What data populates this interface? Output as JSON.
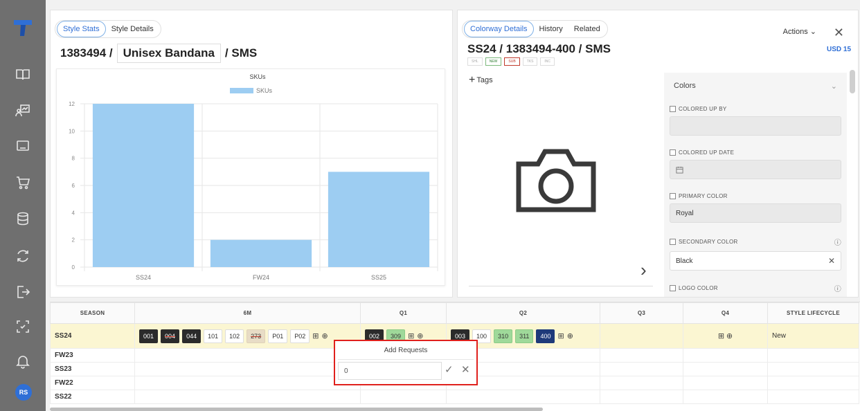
{
  "colors": {
    "sidebar": "#6f6f6f",
    "accent": "#2f6fd6",
    "bar": "#9dcdf2",
    "highlight_row": "#fbf6d2",
    "popup_border": "#e0201c"
  },
  "sidebar": {
    "logo_icon": "t-logo-icon",
    "items": [
      "book-icon",
      "chart-person-icon",
      "laptop-icon",
      "cart-icon",
      "database-icon",
      "sync-icon",
      "export-icon",
      "scan-icon",
      "bell-icon"
    ],
    "avatar": "RS"
  },
  "left": {
    "tabs": [
      {
        "label": "Style Stats",
        "active": true
      },
      {
        "label": "Style Details",
        "active": false
      }
    ],
    "title_prefix": "1383494 /",
    "title_name": "Unisex Bandana",
    "title_suffix": "/ SMS"
  },
  "chart_data": {
    "type": "bar",
    "title": "SKUs",
    "legend": [
      "SKUs"
    ],
    "legend_position": "top",
    "categories": [
      "SS24",
      "FW24",
      "SS25"
    ],
    "series": [
      {
        "name": "SKUs",
        "values": [
          12,
          2,
          7
        ]
      }
    ],
    "ylim": [
      0,
      12
    ],
    "yticks": [
      0,
      2,
      4,
      6,
      8,
      10,
      12
    ],
    "grid": true
  },
  "right": {
    "tabs": [
      {
        "label": "Colorway Details",
        "active": true
      },
      {
        "label": "History",
        "active": false
      },
      {
        "label": "Related",
        "active": false
      }
    ],
    "title": "SS24 / 1383494-400 / SMS",
    "badges": [
      "SHL",
      "NEW",
      "SUB",
      "TKS",
      "INC"
    ],
    "actions_label": "Actions",
    "close_icon": "close-icon",
    "currency": "USD 15",
    "tags_label": "Tags",
    "colors_section": {
      "header": "Colors",
      "fields": [
        {
          "label": "COLORED UP BY",
          "value": ""
        },
        {
          "label": "COLORED UP DATE",
          "value": ""
        },
        {
          "label": "PRIMARY COLOR",
          "value": "Royal"
        },
        {
          "label": "SECONDARY COLOR",
          "value": "Black"
        },
        {
          "label": "LOGO COLOR",
          "value": ""
        }
      ]
    }
  },
  "table": {
    "headers": [
      "SEASON",
      "6M",
      "Q1",
      "Q2",
      "Q3",
      "Q4",
      "STYLE LIFECYCLE"
    ],
    "rows": [
      {
        "season": "SS24",
        "m6": [
          "001",
          "004",
          "044",
          "101",
          "102",
          "273",
          "P01",
          "P02"
        ],
        "q1": [
          "002",
          "309"
        ],
        "q2": [
          "003",
          "100",
          "310",
          "311",
          "400"
        ],
        "lifecycle": "New"
      },
      {
        "season": "FW23"
      },
      {
        "season": "SS23"
      },
      {
        "season": "FW22"
      },
      {
        "season": "SS22"
      }
    ]
  },
  "popup": {
    "title": "Add Requests",
    "input_value": "0"
  }
}
